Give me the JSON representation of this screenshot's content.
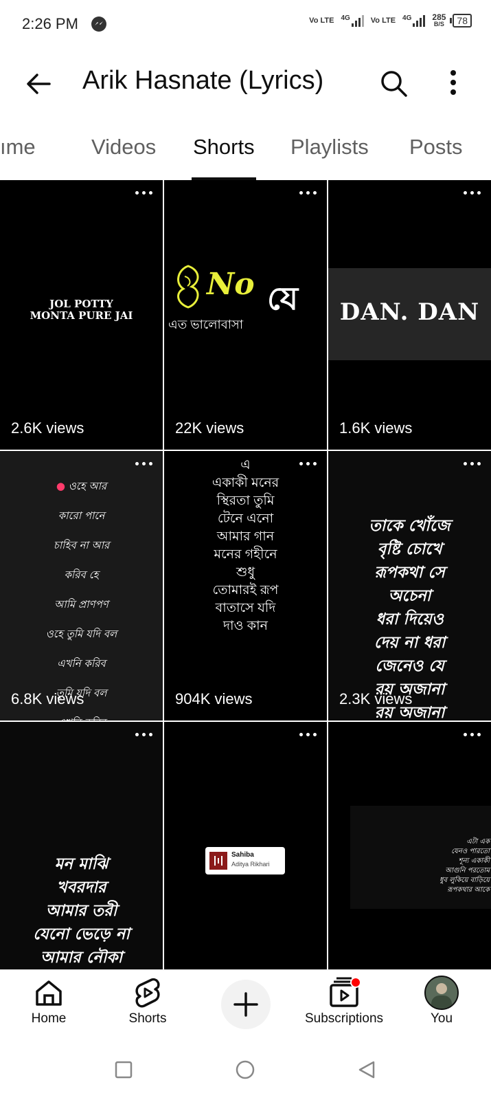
{
  "status_bar": {
    "time": "2:26 PM",
    "net1": "Vo LTE",
    "net1_gen": "4G",
    "net2": "Vo LTE",
    "net2_gen": "4G",
    "speed_value": "285",
    "speed_unit": "B/S",
    "battery": "78"
  },
  "header": {
    "title": "Arik Hasnate (Lyrics)"
  },
  "tabs": [
    {
      "label": "Home",
      "visible_label": "ıme"
    },
    {
      "label": "Videos"
    },
    {
      "label": "Shorts",
      "active": true
    },
    {
      "label": "Playlists"
    },
    {
      "label": "Posts"
    }
  ],
  "shorts": [
    {
      "views": "2.6K views",
      "thumb_text": [
        "JOL POTTY",
        "MONTA PURE JAI"
      ]
    },
    {
      "views": "22K views",
      "thumb_text": [
        "No",
        "যে",
        "এত ভালোবাসা"
      ]
    },
    {
      "views": "1.6K views",
      "thumb_text": [
        "DAN. DAN"
      ]
    },
    {
      "views": "6.8K views",
      "thumb_text": [
        "ওহে আর",
        "কারো পানে",
        "চাহিব না আর",
        "করিব হে",
        "আমি প্রাণপণ",
        "ওহে তুমি যদি বল",
        "এখনি করিব",
        "তুমি যদি বল",
        "এখনি করিব"
      ]
    },
    {
      "views": "904K views",
      "thumb_text": [
        "এ",
        "একাকী মনের",
        "স্থিরতা তুমি",
        "টেনে এনো",
        "আমার গান",
        "মনের গহীনে",
        "শুধু",
        "তোমারই রূপ",
        "বাতাসে যদি",
        "দাও কান"
      ]
    },
    {
      "views": "2.3K views",
      "thumb_text": [
        "তাকে খোঁজে",
        "বৃষ্টি চোখে",
        "রূপকথা সে",
        "অচেনা",
        "ধরা দিয়েও",
        "দেয় না ধরা",
        "জেনেও যে",
        "রয় অজানা",
        "রয় অজানা"
      ]
    },
    {
      "views": "",
      "thumb_text": [
        "মন মাঝি",
        "খবরদার",
        "আমার তরী",
        "যেনো ভেড়ে না",
        "আমার নৌকা"
      ]
    },
    {
      "views": "",
      "thumb_text": [
        "Sahiba",
        "Aditya Rikhari"
      ]
    },
    {
      "views": "",
      "thumb_text": [
        "এটা এক",
        "যেনও পারতো",
        "শূন্য একাকী",
        "আগুনি পরতোম",
        "ধুব লুকিয়ে বাড়িয়ে",
        "রূপকথার আকে"
      ]
    }
  ],
  "bottom_nav": {
    "home": "Home",
    "shorts": "Shorts",
    "create": "Create",
    "subscriptions": "Subscriptions",
    "you": "You"
  },
  "colors": {
    "accent_red": "#ff0000",
    "active_text": "#0f0f0f",
    "inactive_text": "#606060",
    "dan_banner_bg": "#262626",
    "lyric_pink": "#ff3b6b",
    "chip_bg": "#ffffff"
  },
  "icons": [
    "back-arrow-icon",
    "search-icon",
    "more-vert-icon",
    "more-horiz-icon",
    "home-icon",
    "shorts-icon",
    "add-icon",
    "subscriptions-icon",
    "avatar",
    "recent-apps-icon",
    "home-circle-icon",
    "back-triangle-icon"
  ]
}
